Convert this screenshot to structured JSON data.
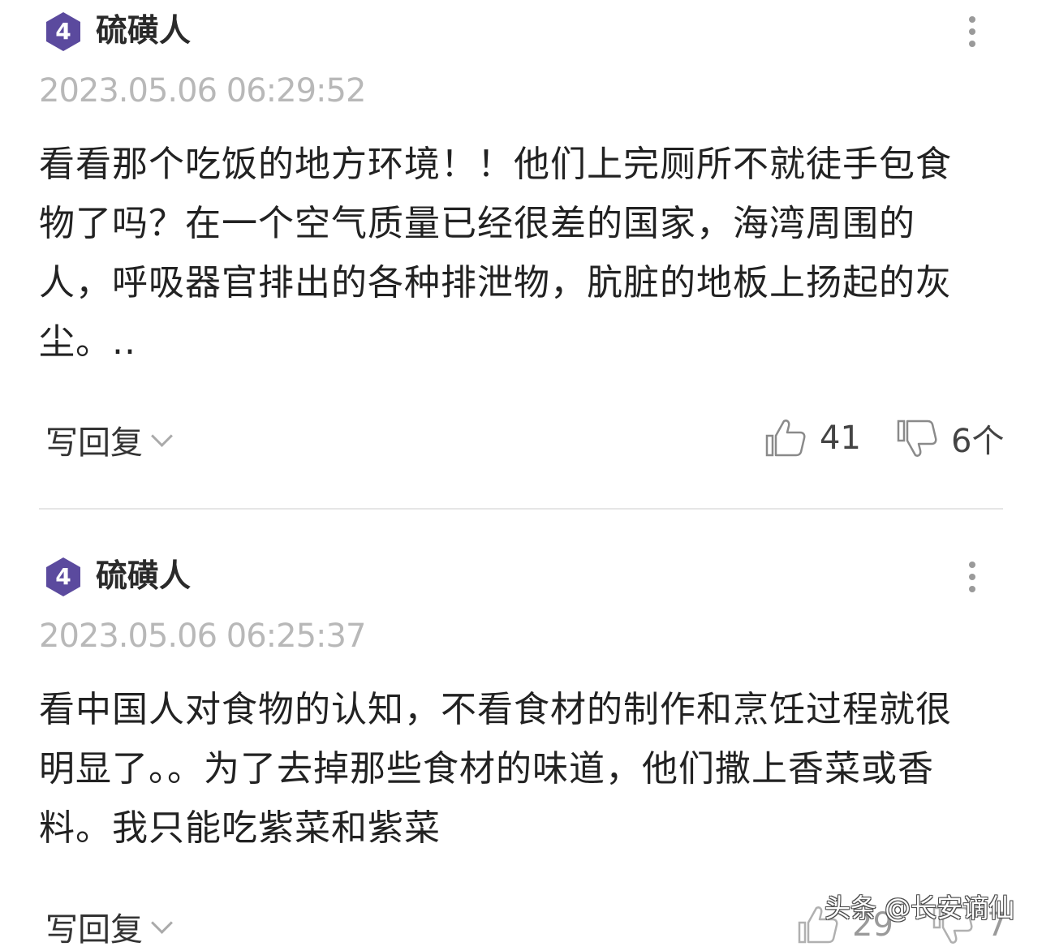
{
  "comments": [
    {
      "level": "4",
      "username": "硫磺人",
      "timestamp": "2023.05.06 06:29:52",
      "text_lines": [
        "看看那个吃饭的地方环境！！他们上完厕所不就徒手包食",
        "物了吗？在一个空气质量已经很差的国家，海湾周围的",
        "人，呼吸器官排出的各种排泄物，肮脏的地板上扬起的灰",
        "尘。.."
      ],
      "reply_label": "写回复",
      "likes": "41",
      "dislikes": "6个"
    },
    {
      "level": "4",
      "username": "硫磺人",
      "timestamp": "2023.05.06 06:25:37",
      "text_lines": [
        "看中国人对食物的认知，不看食材的制作和烹饪过程就很",
        "明显了。。为了去掉那些食材的味道，他们撒上香菜或香",
        "料。我只能吃紫菜和紫菜"
      ],
      "reply_label": "写回复",
      "likes": "29",
      "dislikes": "7"
    }
  ],
  "watermark": "头条 @长安谪仙",
  "colors": {
    "badge": "#5b4a9e",
    "timestamp": "#b8b8b8",
    "divider": "#e6e6e6"
  },
  "icons": {
    "badge": "hexagon-level-icon",
    "more": "more-vertical-icon",
    "like": "thumbs-up-icon",
    "dislike": "thumbs-down-icon",
    "expand": "chevron-down-icon"
  }
}
